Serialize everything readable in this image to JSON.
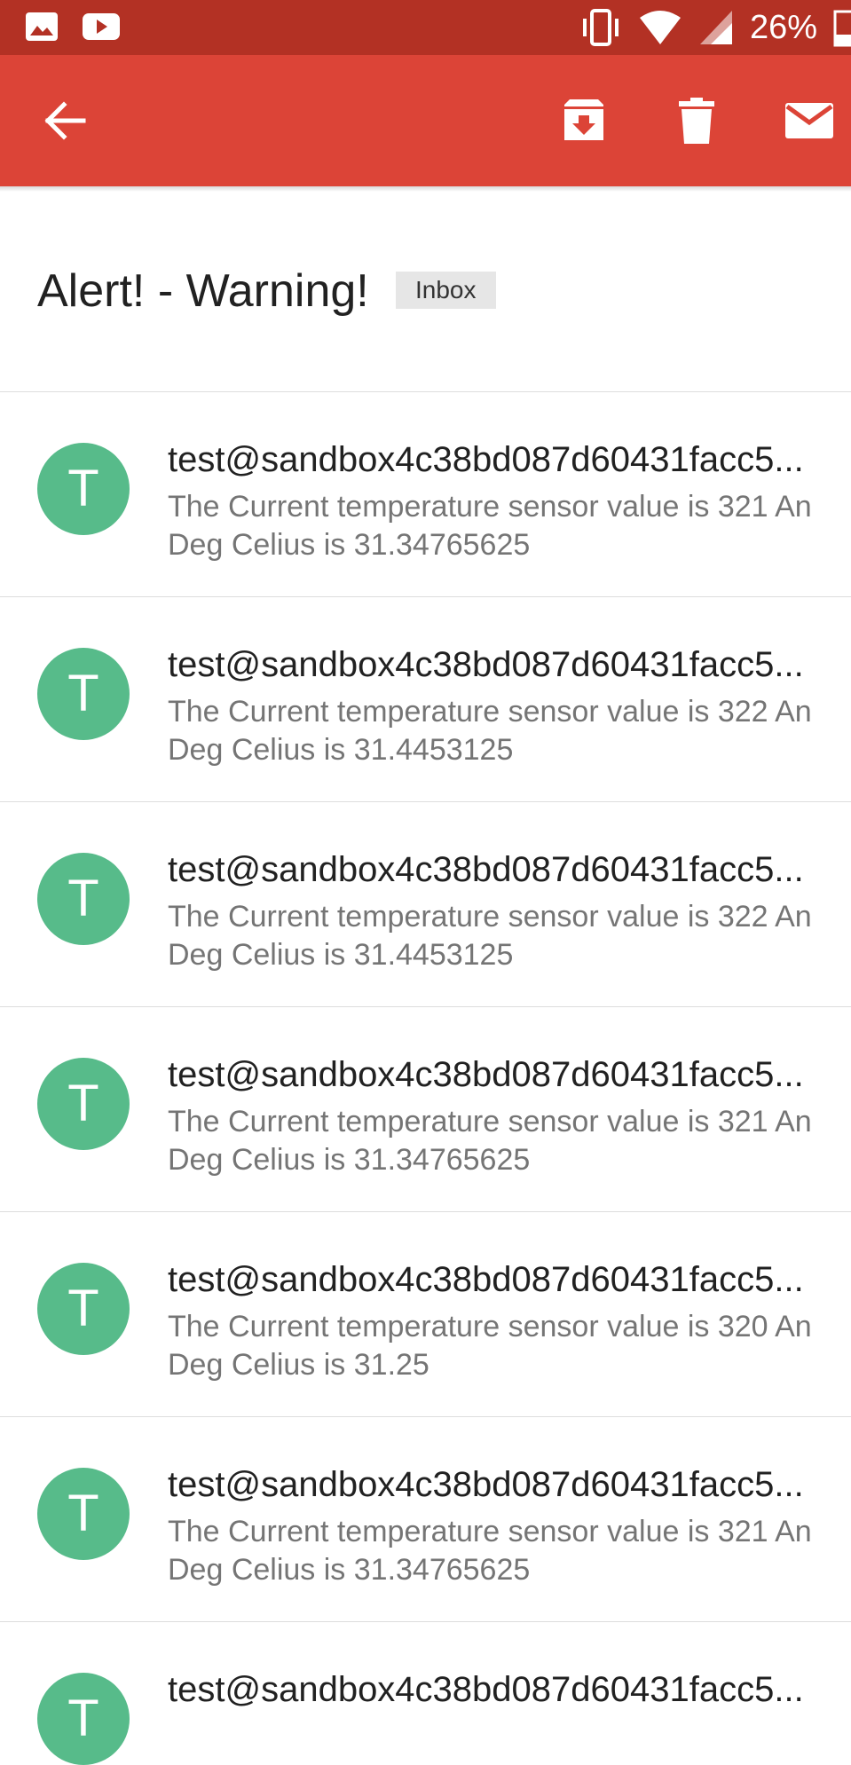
{
  "status_bar": {
    "battery_percent": "26%",
    "icons": [
      "gallery-icon",
      "youtube-icon",
      "vibrate-icon",
      "wifi-icon",
      "cell-signal-icon",
      "battery-icon"
    ]
  },
  "app_bar": {
    "background": "#dc4437",
    "actions": [
      "back-arrow-icon",
      "archive-icon",
      "delete-icon",
      "mark-unread-icon"
    ]
  },
  "thread": {
    "subject": "Alert! - Warning!",
    "label": "Inbox"
  },
  "messages": [
    {
      "avatar_letter": "T",
      "sender": "test@sandbox4c38bd087d60431facc5...",
      "line1": "The Current temperature sensor value is 321 An",
      "line2": "Deg Celius is 31.34765625"
    },
    {
      "avatar_letter": "T",
      "sender": "test@sandbox4c38bd087d60431facc5...",
      "line1": "The Current temperature sensor value is 322 An",
      "line2": "Deg Celius is 31.4453125"
    },
    {
      "avatar_letter": "T",
      "sender": "test@sandbox4c38bd087d60431facc5...",
      "line1": "The Current temperature sensor value is 322 An",
      "line2": "Deg Celius is 31.4453125"
    },
    {
      "avatar_letter": "T",
      "sender": "test@sandbox4c38bd087d60431facc5...",
      "line1": "The Current temperature sensor value is 321 An",
      "line2": "Deg Celius is 31.34765625"
    },
    {
      "avatar_letter": "T",
      "sender": "test@sandbox4c38bd087d60431facc5...",
      "line1": "The Current temperature sensor value is 320 An",
      "line2": "Deg Celius is 31.25"
    },
    {
      "avatar_letter": "T",
      "sender": "test@sandbox4c38bd087d60431facc5...",
      "line1": "The Current temperature sensor value is 321 An",
      "line2": "Deg Celius is 31.34765625"
    },
    {
      "avatar_letter": "T",
      "sender": "test@sandbox4c38bd087d60431facc5...",
      "line1": "",
      "line2": ""
    }
  ],
  "colors": {
    "status_bar": "#b33124",
    "avatar": "#57bb8a"
  }
}
